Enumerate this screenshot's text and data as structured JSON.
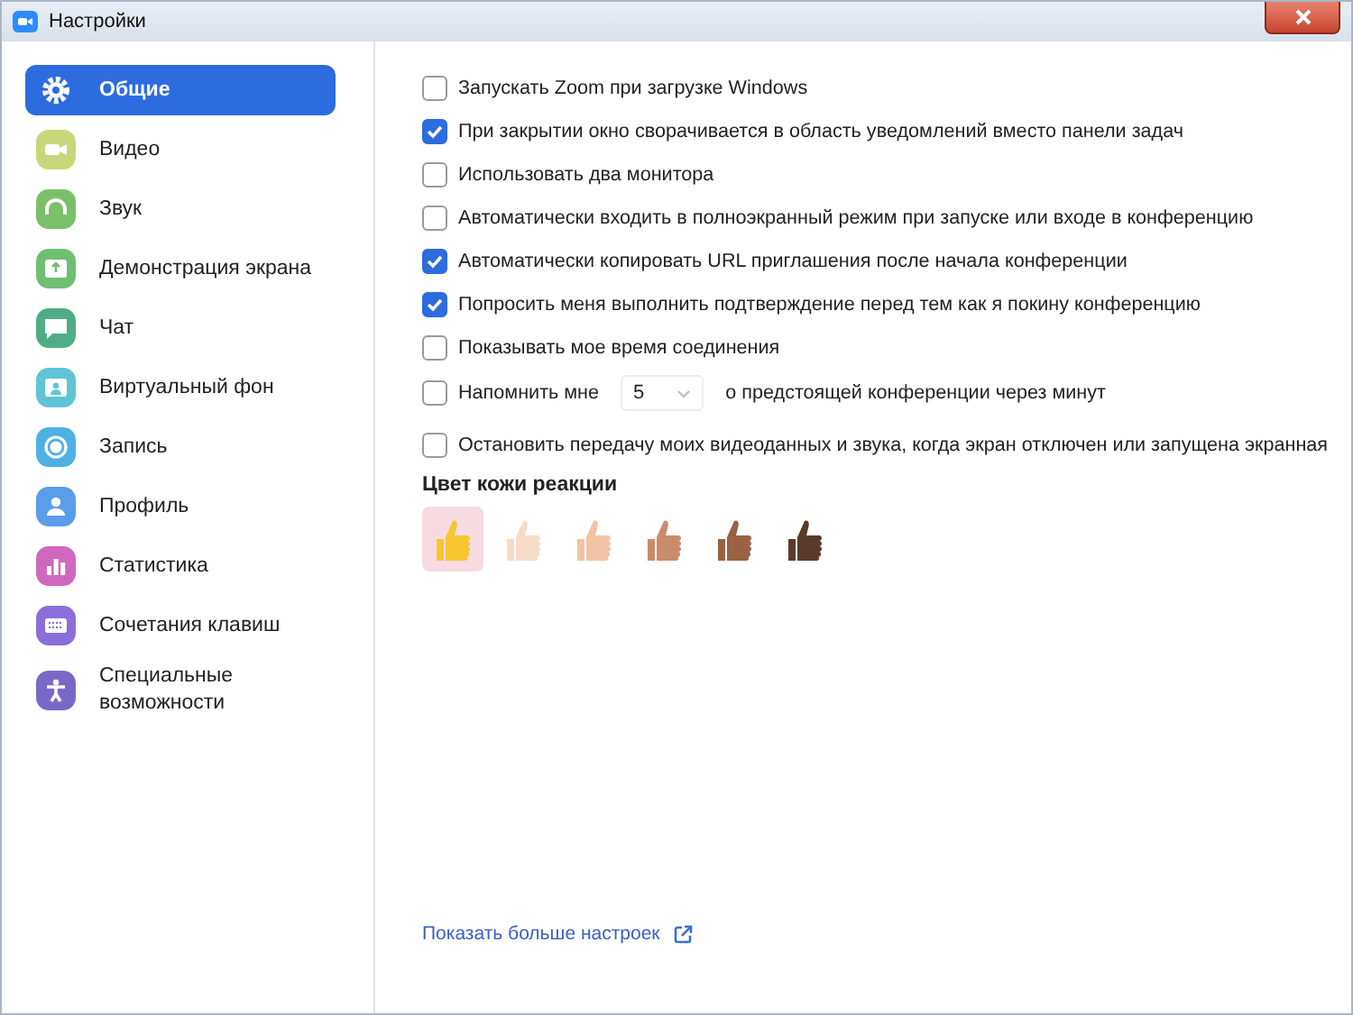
{
  "window": {
    "title": "Настройки"
  },
  "sidebar": {
    "items": [
      {
        "label": "Общие",
        "selected": true,
        "color": "#ffffff"
      },
      {
        "label": "Видео",
        "selected": false,
        "color": "#c9d77a"
      },
      {
        "label": "Звук",
        "selected": false,
        "color": "#7cbf6a"
      },
      {
        "label": "Демонстрация экрана",
        "selected": false,
        "color": "#6fbf73"
      },
      {
        "label": "Чат",
        "selected": false,
        "color": "#4fae88"
      },
      {
        "label": "Виртуальный фон",
        "selected": false,
        "color": "#5ec4d6"
      },
      {
        "label": "Запись",
        "selected": false,
        "color": "#4fb0e6"
      },
      {
        "label": "Профиль",
        "selected": false,
        "color": "#5a9de8"
      },
      {
        "label": "Статистика",
        "selected": false,
        "color": "#d068c0"
      },
      {
        "label": "Сочетания клавиш",
        "selected": false,
        "color": "#8a6fd8"
      },
      {
        "label": "Специальные возможности",
        "selected": false,
        "color": "#7a68c8"
      }
    ]
  },
  "options": [
    {
      "kind": "check",
      "label": "Запускать Zoom при загрузке Windows",
      "checked": false
    },
    {
      "kind": "check",
      "label": "При закрытии окно сворачивается в область уведомлений вместо панели задач",
      "checked": true
    },
    {
      "kind": "check",
      "label": "Использовать два монитора",
      "checked": false
    },
    {
      "kind": "check",
      "label": "Автоматически входить в полноэкранный режим при запуске или входе в конференцию",
      "checked": false
    },
    {
      "kind": "check",
      "label": "Автоматически копировать URL приглашения после начала конференции",
      "checked": true
    },
    {
      "kind": "check",
      "label": "Попросить меня выполнить подтверждение перед тем как я покину конференцию",
      "checked": true
    },
    {
      "kind": "check",
      "label": "Показывать мое время соединения",
      "checked": false
    },
    {
      "kind": "reminder",
      "label": "Напомнить мне",
      "value": "5",
      "suffix": "о предстоящей конференции через минут",
      "checked": false
    },
    {
      "kind": "check",
      "label": "Остановить передачу моих видеоданных и звука, когда экран отключен или запущена экранная",
      "checked": false
    }
  ],
  "skin_tone": {
    "title": "Цвет кожи реакции",
    "tones": [
      {
        "color": "#f7c631",
        "selected": true
      },
      {
        "color": "#f6dcc8",
        "selected": false
      },
      {
        "color": "#f1c3a4",
        "selected": false
      },
      {
        "color": "#c98c6a",
        "selected": false
      },
      {
        "color": "#9a6143",
        "selected": false
      },
      {
        "color": "#5a3a2a",
        "selected": false
      }
    ]
  },
  "more_link": "Показать больше настроек"
}
